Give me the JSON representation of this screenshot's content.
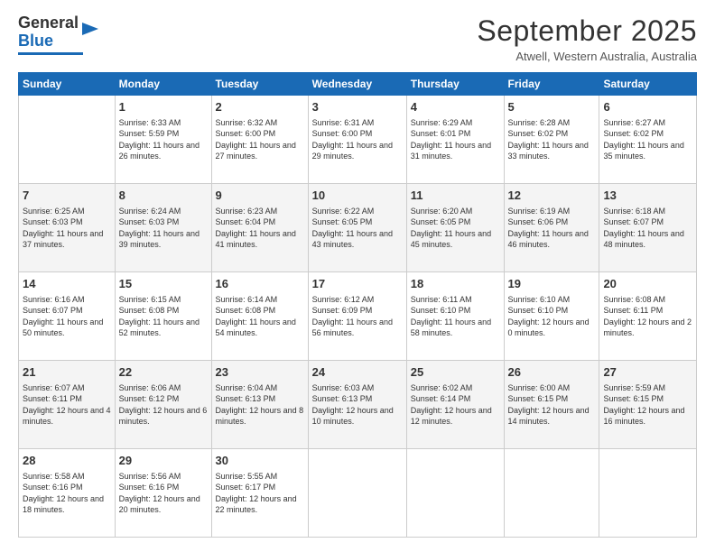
{
  "header": {
    "logo_line1": "General",
    "logo_line2": "Blue",
    "month": "September 2025",
    "location": "Atwell, Western Australia, Australia"
  },
  "weekdays": [
    "Sunday",
    "Monday",
    "Tuesday",
    "Wednesday",
    "Thursday",
    "Friday",
    "Saturday"
  ],
  "weeks": [
    [
      {
        "day": "",
        "sunrise": "",
        "sunset": "",
        "daylight": ""
      },
      {
        "day": "1",
        "sunrise": "Sunrise: 6:33 AM",
        "sunset": "Sunset: 5:59 PM",
        "daylight": "Daylight: 11 hours and 26 minutes."
      },
      {
        "day": "2",
        "sunrise": "Sunrise: 6:32 AM",
        "sunset": "Sunset: 6:00 PM",
        "daylight": "Daylight: 11 hours and 27 minutes."
      },
      {
        "day": "3",
        "sunrise": "Sunrise: 6:31 AM",
        "sunset": "Sunset: 6:00 PM",
        "daylight": "Daylight: 11 hours and 29 minutes."
      },
      {
        "day": "4",
        "sunrise": "Sunrise: 6:29 AM",
        "sunset": "Sunset: 6:01 PM",
        "daylight": "Daylight: 11 hours and 31 minutes."
      },
      {
        "day": "5",
        "sunrise": "Sunrise: 6:28 AM",
        "sunset": "Sunset: 6:02 PM",
        "daylight": "Daylight: 11 hours and 33 minutes."
      },
      {
        "day": "6",
        "sunrise": "Sunrise: 6:27 AM",
        "sunset": "Sunset: 6:02 PM",
        "daylight": "Daylight: 11 hours and 35 minutes."
      }
    ],
    [
      {
        "day": "7",
        "sunrise": "Sunrise: 6:25 AM",
        "sunset": "Sunset: 6:03 PM",
        "daylight": "Daylight: 11 hours and 37 minutes."
      },
      {
        "day": "8",
        "sunrise": "Sunrise: 6:24 AM",
        "sunset": "Sunset: 6:03 PM",
        "daylight": "Daylight: 11 hours and 39 minutes."
      },
      {
        "day": "9",
        "sunrise": "Sunrise: 6:23 AM",
        "sunset": "Sunset: 6:04 PM",
        "daylight": "Daylight: 11 hours and 41 minutes."
      },
      {
        "day": "10",
        "sunrise": "Sunrise: 6:22 AM",
        "sunset": "Sunset: 6:05 PM",
        "daylight": "Daylight: 11 hours and 43 minutes."
      },
      {
        "day": "11",
        "sunrise": "Sunrise: 6:20 AM",
        "sunset": "Sunset: 6:05 PM",
        "daylight": "Daylight: 11 hours and 45 minutes."
      },
      {
        "day": "12",
        "sunrise": "Sunrise: 6:19 AM",
        "sunset": "Sunset: 6:06 PM",
        "daylight": "Daylight: 11 hours and 46 minutes."
      },
      {
        "day": "13",
        "sunrise": "Sunrise: 6:18 AM",
        "sunset": "Sunset: 6:07 PM",
        "daylight": "Daylight: 11 hours and 48 minutes."
      }
    ],
    [
      {
        "day": "14",
        "sunrise": "Sunrise: 6:16 AM",
        "sunset": "Sunset: 6:07 PM",
        "daylight": "Daylight: 11 hours and 50 minutes."
      },
      {
        "day": "15",
        "sunrise": "Sunrise: 6:15 AM",
        "sunset": "Sunset: 6:08 PM",
        "daylight": "Daylight: 11 hours and 52 minutes."
      },
      {
        "day": "16",
        "sunrise": "Sunrise: 6:14 AM",
        "sunset": "Sunset: 6:08 PM",
        "daylight": "Daylight: 11 hours and 54 minutes."
      },
      {
        "day": "17",
        "sunrise": "Sunrise: 6:12 AM",
        "sunset": "Sunset: 6:09 PM",
        "daylight": "Daylight: 11 hours and 56 minutes."
      },
      {
        "day": "18",
        "sunrise": "Sunrise: 6:11 AM",
        "sunset": "Sunset: 6:10 PM",
        "daylight": "Daylight: 11 hours and 58 minutes."
      },
      {
        "day": "19",
        "sunrise": "Sunrise: 6:10 AM",
        "sunset": "Sunset: 6:10 PM",
        "daylight": "Daylight: 12 hours and 0 minutes."
      },
      {
        "day": "20",
        "sunrise": "Sunrise: 6:08 AM",
        "sunset": "Sunset: 6:11 PM",
        "daylight": "Daylight: 12 hours and 2 minutes."
      }
    ],
    [
      {
        "day": "21",
        "sunrise": "Sunrise: 6:07 AM",
        "sunset": "Sunset: 6:11 PM",
        "daylight": "Daylight: 12 hours and 4 minutes."
      },
      {
        "day": "22",
        "sunrise": "Sunrise: 6:06 AM",
        "sunset": "Sunset: 6:12 PM",
        "daylight": "Daylight: 12 hours and 6 minutes."
      },
      {
        "day": "23",
        "sunrise": "Sunrise: 6:04 AM",
        "sunset": "Sunset: 6:13 PM",
        "daylight": "Daylight: 12 hours and 8 minutes."
      },
      {
        "day": "24",
        "sunrise": "Sunrise: 6:03 AM",
        "sunset": "Sunset: 6:13 PM",
        "daylight": "Daylight: 12 hours and 10 minutes."
      },
      {
        "day": "25",
        "sunrise": "Sunrise: 6:02 AM",
        "sunset": "Sunset: 6:14 PM",
        "daylight": "Daylight: 12 hours and 12 minutes."
      },
      {
        "day": "26",
        "sunrise": "Sunrise: 6:00 AM",
        "sunset": "Sunset: 6:15 PM",
        "daylight": "Daylight: 12 hours and 14 minutes."
      },
      {
        "day": "27",
        "sunrise": "Sunrise: 5:59 AM",
        "sunset": "Sunset: 6:15 PM",
        "daylight": "Daylight: 12 hours and 16 minutes."
      }
    ],
    [
      {
        "day": "28",
        "sunrise": "Sunrise: 5:58 AM",
        "sunset": "Sunset: 6:16 PM",
        "daylight": "Daylight: 12 hours and 18 minutes."
      },
      {
        "day": "29",
        "sunrise": "Sunrise: 5:56 AM",
        "sunset": "Sunset: 6:16 PM",
        "daylight": "Daylight: 12 hours and 20 minutes."
      },
      {
        "day": "30",
        "sunrise": "Sunrise: 5:55 AM",
        "sunset": "Sunset: 6:17 PM",
        "daylight": "Daylight: 12 hours and 22 minutes."
      },
      {
        "day": "",
        "sunrise": "",
        "sunset": "",
        "daylight": ""
      },
      {
        "day": "",
        "sunrise": "",
        "sunset": "",
        "daylight": ""
      },
      {
        "day": "",
        "sunrise": "",
        "sunset": "",
        "daylight": ""
      },
      {
        "day": "",
        "sunrise": "",
        "sunset": "",
        "daylight": ""
      }
    ]
  ]
}
